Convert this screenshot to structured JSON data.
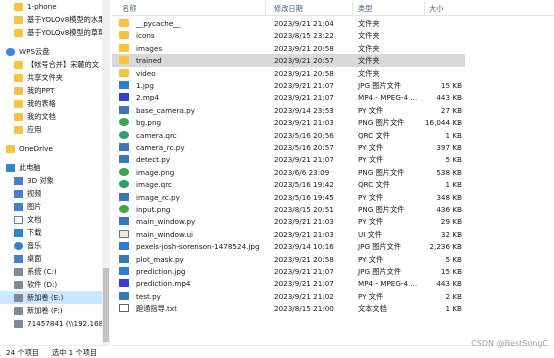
{
  "nav": {
    "items": [
      {
        "label": "1-phone",
        "icon": "folder-icon",
        "kind": "folder"
      },
      {
        "label": "基于YOLOv8模型的水果",
        "icon": "folder-icon",
        "kind": "folder"
      },
      {
        "label": "基于YOLOv8模型的草莓",
        "icon": "folder-icon",
        "kind": "folder"
      },
      {
        "label": "",
        "icon": "",
        "kind": "spacer"
      },
      {
        "label": "WPS云盘",
        "icon": "cloud-icon",
        "kind": "cloud"
      },
      {
        "label": "【帐号合并】宋麓的文",
        "icon": "folder-icon",
        "kind": "folder"
      },
      {
        "label": "共享文件夹",
        "icon": "shared-folder-icon",
        "kind": "folder"
      },
      {
        "label": "我的PPT",
        "icon": "folder-icon",
        "kind": "folder"
      },
      {
        "label": "我的表格",
        "icon": "folder-icon",
        "kind": "folder"
      },
      {
        "label": "我的文档",
        "icon": "folder-icon",
        "kind": "folder"
      },
      {
        "label": "应用",
        "icon": "folder-icon",
        "kind": "folder"
      },
      {
        "label": "",
        "icon": "",
        "kind": "spacer"
      },
      {
        "label": "OneDrive",
        "icon": "onedrive-folder-icon",
        "kind": "folder"
      },
      {
        "label": "",
        "icon": "",
        "kind": "spacer"
      },
      {
        "label": "此电脑",
        "icon": "computer-icon",
        "kind": "pc"
      },
      {
        "label": "3D 对象",
        "icon": "3d-objects-icon",
        "kind": "grid"
      },
      {
        "label": "视频",
        "icon": "video-icon",
        "kind": "grid"
      },
      {
        "label": "图片",
        "icon": "pictures-icon",
        "kind": "grid"
      },
      {
        "label": "文档",
        "icon": "documents-icon",
        "kind": "doc"
      },
      {
        "label": "下载",
        "icon": "download-icon",
        "kind": "dl"
      },
      {
        "label": "音乐",
        "icon": "music-icon",
        "kind": "music"
      },
      {
        "label": "桌面",
        "icon": "desktop-icon",
        "kind": "grid"
      },
      {
        "label": "系统 (C:)",
        "icon": "drive-icon",
        "kind": "drive"
      },
      {
        "label": "软件 (D:)",
        "icon": "drive-icon",
        "kind": "drive"
      },
      {
        "label": "新加卷 (E:)",
        "icon": "drive-icon",
        "kind": "drive",
        "selected": true
      },
      {
        "label": "新加卷 (F:)",
        "icon": "drive-icon",
        "kind": "drive"
      },
      {
        "label": "71457841 (\\\\192.168",
        "icon": "network-drive-icon",
        "kind": "drive"
      }
    ]
  },
  "header": {
    "name": "名称",
    "date": "修改日期",
    "type": "类型",
    "size": "大小"
  },
  "files": [
    {
      "name": "__pycache__",
      "date": "2023/9/21 21:04",
      "type": "文件夹",
      "size": "",
      "kind": "folder"
    },
    {
      "name": "icons",
      "date": "2023/8/15 23:22",
      "type": "文件夹",
      "size": "",
      "kind": "folder"
    },
    {
      "name": "images",
      "date": "2023/9/21 20:58",
      "type": "文件夹",
      "size": "",
      "kind": "folder"
    },
    {
      "name": "trained",
      "date": "2023/9/21 20:57",
      "type": "文件夹",
      "size": "",
      "kind": "folder",
      "selected": true
    },
    {
      "name": "video",
      "date": "2023/9/21 20:58",
      "type": "文件夹",
      "size": "",
      "kind": "folder"
    },
    {
      "name": "1.jpg",
      "date": "2023/9/21 21:07",
      "type": "JPG 图片文件",
      "size": "15 KB",
      "kind": "jpg"
    },
    {
      "name": "2.mp4",
      "date": "2023/9/21 21:07",
      "type": "MP4 - MPEG-4 ...",
      "size": "443 KB",
      "kind": "mp4"
    },
    {
      "name": "base_camera.py",
      "date": "2023/9/14 23:53",
      "type": "PY 文件",
      "size": "27 KB",
      "kind": "py"
    },
    {
      "name": "bg.png",
      "date": "2023/9/21 21:03",
      "type": "PNG 图片文件",
      "size": "16,044 KB",
      "kind": "png"
    },
    {
      "name": "camera.qrc",
      "date": "2023/5/16 20:56",
      "type": "QRC 文件",
      "size": "1 KB",
      "kind": "qrc"
    },
    {
      "name": "camera_rc.py",
      "date": "2023/5/16 20:57",
      "type": "PY 文件",
      "size": "397 KB",
      "kind": "py"
    },
    {
      "name": "detect.py",
      "date": "2023/9/21 21:07",
      "type": "PY 文件",
      "size": "5 KB",
      "kind": "py"
    },
    {
      "name": "image.png",
      "date": "2023/6/6 23:09",
      "type": "PNG 图片文件",
      "size": "538 KB",
      "kind": "png"
    },
    {
      "name": "image.qrc",
      "date": "2023/5/16 19:42",
      "type": "QRC 文件",
      "size": "1 KB",
      "kind": "qrc"
    },
    {
      "name": "image_rc.py",
      "date": "2023/5/16 19:45",
      "type": "PY 文件",
      "size": "348 KB",
      "kind": "py"
    },
    {
      "name": "input.png",
      "date": "2023/8/15 20:51",
      "type": "PNG 图片文件",
      "size": "436 KB",
      "kind": "png"
    },
    {
      "name": "main_window.py",
      "date": "2023/9/21 21:03",
      "type": "PY 文件",
      "size": "29 KB",
      "kind": "py"
    },
    {
      "name": "main_window.ui",
      "date": "2023/9/21 21:03",
      "type": "UI 文件",
      "size": "32 KB",
      "kind": "ui"
    },
    {
      "name": "pexels-josh-sorenson-1478524.jpg",
      "date": "2023/9/14 10:16",
      "type": "JPG 图片文件",
      "size": "2,236 KB",
      "kind": "jpg"
    },
    {
      "name": "plot_mask.py",
      "date": "2023/9/21 20:58",
      "type": "PY 文件",
      "size": "5 KB",
      "kind": "py"
    },
    {
      "name": "prediction.jpg",
      "date": "2023/9/21 21:07",
      "type": "JPG 图片文件",
      "size": "15 KB",
      "kind": "jpg"
    },
    {
      "name": "prediction.mp4",
      "date": "2023/9/21 21:07",
      "type": "MP4 - MPEG-4 ...",
      "size": "443 KB",
      "kind": "mp4"
    },
    {
      "name": "test.py",
      "date": "2023/9/21 21:02",
      "type": "PY 文件",
      "size": "2 KB",
      "kind": "py"
    },
    {
      "name": "跑通指导.txt",
      "date": "2023/8/15 21:00",
      "type": "文本文档",
      "size": "1 KB",
      "kind": "txt"
    }
  ],
  "status": {
    "count": "24 个项目",
    "selected": "选中 1 个项目"
  },
  "watermark": "CSDN @BestSongC",
  "colors": {
    "selection": "#d9d9d9",
    "nav_selection": "#cce8ff",
    "folder": "#f5c542",
    "header_text": "#4c607a"
  }
}
